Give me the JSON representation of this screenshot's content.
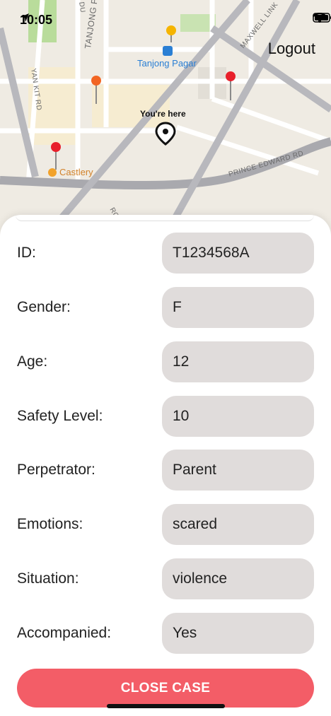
{
  "status_bar": {
    "time": "10:05"
  },
  "header": {
    "logout_label": "Logout"
  },
  "map": {
    "labels": {
      "street_tanjong_pagar": "TANJONG PAGAR RD",
      "street_yan_kit": "YAN KIT RD",
      "street_maxwell": "MAXWELL LINK",
      "street_prince_edward": "PRINCE EDWARD RD",
      "street_du": "DU",
      "street_ro": "RO",
      "station": "Tanjong Pagar",
      "castlery": "Castlery",
      "you_are_here": "You're here"
    },
    "pin_colors": {
      "red": "#e8202b",
      "orange": "#f26522",
      "yellow": "#f5b400"
    }
  },
  "details": {
    "rows": [
      {
        "label": "ID:",
        "value": "T1234568A"
      },
      {
        "label": "Gender:",
        "value": "F"
      },
      {
        "label": "Age:",
        "value": "12"
      },
      {
        "label": "Safety Level:",
        "value": "10"
      },
      {
        "label": "Perpetrator:",
        "value": "Parent"
      },
      {
        "label": "Emotions:",
        "value": "scared"
      },
      {
        "label": "Situation:",
        "value": "violence"
      },
      {
        "label": "Accompanied:",
        "value": "Yes"
      }
    ]
  },
  "actions": {
    "close_case_label": "CLOSE CASE",
    "close_case_color": "#f35d67"
  }
}
